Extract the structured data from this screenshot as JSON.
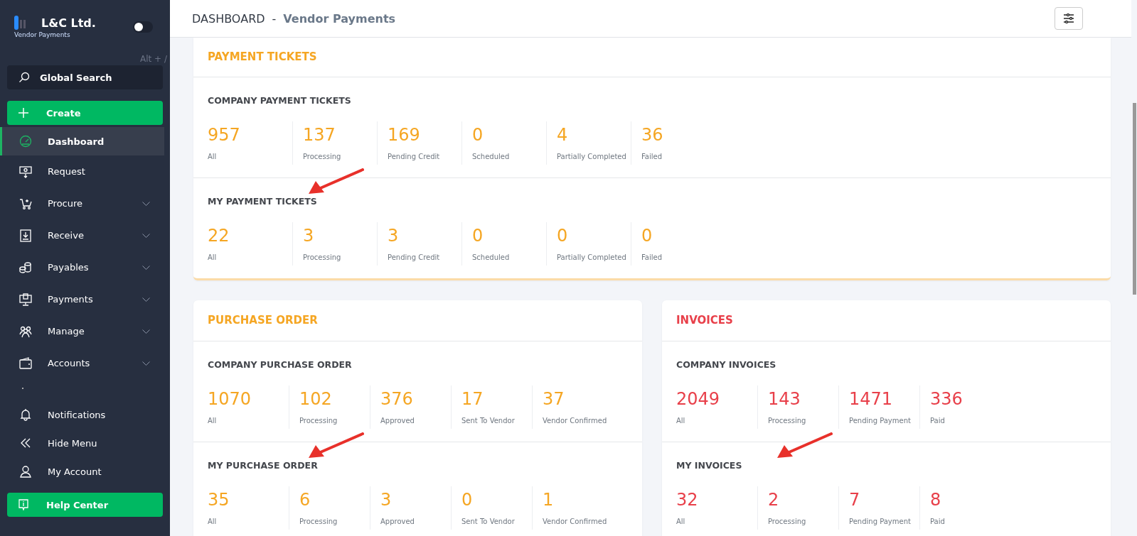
{
  "sidebar": {
    "brand": {
      "name": "L&C Ltd.",
      "subtitle": "Vendor Payments"
    },
    "theme_toggle": {
      "on": false
    },
    "shortcut": "Alt + /",
    "search": {
      "placeholder": "Global Search"
    },
    "create_button": "Create",
    "items": [
      {
        "label": "Dashboard",
        "selected": true
      },
      {
        "label": "Request",
        "selected": false
      },
      {
        "label": "Procure",
        "selected": false,
        "expanded": false
      },
      {
        "label": "Receive",
        "selected": false,
        "expanded": false
      },
      {
        "label": "Payables",
        "selected": false,
        "expanded": false
      },
      {
        "label": "Payments",
        "selected": false,
        "expanded": false
      },
      {
        "label": "Manage",
        "selected": false,
        "expanded": false
      },
      {
        "label": "Accounts",
        "selected": false,
        "expanded": false
      }
    ],
    "bottom_items": [
      {
        "label": "Notifications"
      },
      {
        "label": "Hide Menu"
      },
      {
        "label": "My Account"
      }
    ],
    "help_button": "Help Center"
  },
  "header": {
    "title": "DASHBOARD",
    "separator": "-",
    "subtitle": "Vendor Payments"
  },
  "cards": [
    {
      "title": "PAYMENT TICKETS",
      "color": "#f5a623",
      "wide": true,
      "sections": [
        {
          "title": "COMPANY PAYMENT TICKETS",
          "annotated": false,
          "stats": [
            {
              "value": "957",
              "label": "All"
            },
            {
              "value": "137",
              "label": "Processing"
            },
            {
              "value": "169",
              "label": "Pending Credit"
            },
            {
              "value": "0",
              "label": "Scheduled"
            },
            {
              "value": "4",
              "label": "Partially Completed"
            },
            {
              "value": "36",
              "label": "Failed"
            }
          ]
        },
        {
          "title": "MY PAYMENT TICKETS",
          "annotated": true,
          "stats": [
            {
              "value": "22",
              "label": "All"
            },
            {
              "value": "3",
              "label": "Processing"
            },
            {
              "value": "3",
              "label": "Pending Credit"
            },
            {
              "value": "0",
              "label": "Scheduled"
            },
            {
              "value": "0",
              "label": "Partially Completed"
            },
            {
              "value": "0",
              "label": "Failed"
            }
          ]
        }
      ]
    },
    {
      "title": "PURCHASE ORDER",
      "color": "#f5a623",
      "wide": false,
      "sections": [
        {
          "title": "COMPANY PURCHASE ORDER",
          "annotated": false,
          "stats": [
            {
              "value": "1070",
              "label": "All"
            },
            {
              "value": "102",
              "label": "Processing"
            },
            {
              "value": "376",
              "label": "Approved"
            },
            {
              "value": "17",
              "label": "Sent To Vendor"
            },
            {
              "value": "37",
              "label": "Vendor Confirmed"
            }
          ]
        },
        {
          "title": "MY PURCHASE ORDER",
          "annotated": true,
          "stats": [
            {
              "value": "35",
              "label": "All"
            },
            {
              "value": "6",
              "label": "Processing"
            },
            {
              "value": "3",
              "label": "Approved"
            },
            {
              "value": "0",
              "label": "Sent To Vendor"
            },
            {
              "value": "1",
              "label": "Vendor Confirmed"
            }
          ]
        }
      ]
    },
    {
      "title": "INVOICES",
      "color": "#e8404a",
      "wide": false,
      "sections": [
        {
          "title": "COMPANY INVOICES",
          "annotated": false,
          "stats": [
            {
              "value": "2049",
              "label": "All"
            },
            {
              "value": "143",
              "label": "Processing"
            },
            {
              "value": "1471",
              "label": "Pending Payment"
            },
            {
              "value": "336",
              "label": "Paid"
            }
          ]
        },
        {
          "title": "MY INVOICES",
          "annotated": true,
          "stats": [
            {
              "value": "32",
              "label": "All"
            },
            {
              "value": "2",
              "label": "Processing"
            },
            {
              "value": "7",
              "label": "Pending Payment"
            },
            {
              "value": "8",
              "label": "Paid"
            }
          ]
        }
      ]
    }
  ]
}
